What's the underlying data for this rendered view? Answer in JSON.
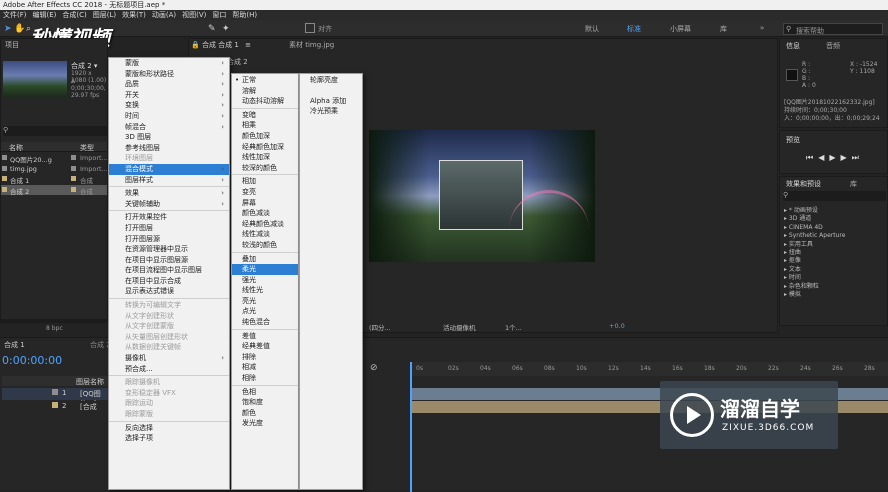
{
  "window": {
    "title": "Adobe After Effects CC 2018 - 无标题项目.aep *"
  },
  "menubar": [
    "文件(F)",
    "编辑(E)",
    "合成(C)",
    "图层(L)",
    "效果(T)",
    "动画(A)",
    "视图(V)",
    "窗口",
    "帮助(H)"
  ],
  "toolbar": {
    "align_label": "对齐",
    "workspaces": [
      "默认",
      "标准",
      "小屏幕",
      "库"
    ],
    "active_workspace": "标准",
    "search_placeholder": "搜索帮助"
  },
  "watermark_top": "秒懂视频",
  "project_panel": {
    "tab": "项目",
    "selected": "合成 2 ▾",
    "info_lines": [
      "1920 x 1080 (1.00)",
      "Δ 0;00;30;00, 29.97 fps"
    ],
    "search_icon": "search-icon",
    "columns": [
      "名称",
      "类型"
    ],
    "items": [
      {
        "name": "QQ图片20...g",
        "type": "Import...",
        "color": "#8f8f8f"
      },
      {
        "name": "timg.jpg",
        "type": "Import...",
        "color": "#8f8f8f"
      },
      {
        "name": "合成 1",
        "type": "合成",
        "color": "#c8b07a"
      },
      {
        "name": "合成 2",
        "type": "合成",
        "color": "#c8b07a"
      }
    ],
    "bpc": "8 bpc"
  },
  "comp_panel": {
    "tabs": [
      "合成 合成 1",
      "素材 timg.jpg"
    ],
    "subtab": "合成 2",
    "zoom": "(四分...",
    "camera": "活动摄像机",
    "views": "1个...",
    "exposure": "+0.0"
  },
  "info_panel": {
    "tabs": [
      "信息",
      "音频"
    ],
    "channels": [
      "R :",
      "G :",
      "B :",
      "A : 0"
    ],
    "coords": [
      "X : -1524",
      "Y : 1108"
    ],
    "file_lines": [
      "[QQ图片20181022162332.jpg]",
      "持续时间：0;00;30;00",
      "入：0;00;00;00，出：0;00;29;24"
    ]
  },
  "preview_panel": {
    "tab": "预览"
  },
  "effects_panel": {
    "tabs": [
      "效果和预设",
      "库"
    ],
    "items": [
      "* 动画预设",
      "3D 通道",
      "CINEMA 4D",
      "Synthetic Aperture",
      "实用工具",
      "扭曲",
      "抠像",
      "文本",
      "时间",
      "杂色和颗粒",
      "模拟"
    ]
  },
  "timeline": {
    "tabs": [
      "合成 1",
      "合成 2"
    ],
    "timecode": "0:00:00:00",
    "col_header": "图层名称",
    "layers": [
      {
        "num": "1",
        "name": "[QQ图片...]"
      },
      {
        "num": "2",
        "name": "[合成"
      }
    ],
    "ruler": [
      "0s",
      "02s",
      "04s",
      "06s",
      "08s",
      "10s",
      "12s",
      "14s",
      "16s",
      "18s",
      "20s",
      "22s",
      "24s",
      "26s",
      "28s"
    ]
  },
  "context_menu": {
    "items": [
      {
        "label": "蒙版",
        "arrow": true
      },
      {
        "label": "蒙版和形状路径",
        "arrow": true
      },
      {
        "label": "品质",
        "arrow": true
      },
      {
        "label": "开关",
        "arrow": true
      },
      {
        "label": "变换",
        "arrow": true
      },
      {
        "label": "时间",
        "arrow": true
      },
      {
        "label": "帧混合",
        "arrow": true
      },
      {
        "label": "3D 图层"
      },
      {
        "label": "参考线图层"
      },
      {
        "label": "环境图层",
        "disabled": true
      },
      {
        "label": "混合模式",
        "arrow": true,
        "selected": true
      },
      {
        "label": "图层样式",
        "arrow": true
      },
      {
        "sep": true
      },
      {
        "label": "效果",
        "arrow": true
      },
      {
        "label": "关键帧辅助",
        "arrow": true
      },
      {
        "sep": true
      },
      {
        "label": "打开效果控件"
      },
      {
        "label": "打开图层"
      },
      {
        "label": "打开图层源"
      },
      {
        "label": "在资源管理器中显示"
      },
      {
        "label": "在项目中显示图层源"
      },
      {
        "label": "在项目流程图中显示图层"
      },
      {
        "label": "在项目中显示合成"
      },
      {
        "label": "显示表达式错误"
      },
      {
        "sep": true
      },
      {
        "label": "转换为可编辑文字",
        "disabled": true
      },
      {
        "label": "从文字创建形状",
        "disabled": true
      },
      {
        "label": "从文字创建蒙版",
        "disabled": true
      },
      {
        "label": "从矢量图层创建形状",
        "disabled": true
      },
      {
        "label": "从数据创建关键帧",
        "disabled": true
      },
      {
        "label": "摄像机",
        "arrow": true
      },
      {
        "label": "预合成..."
      },
      {
        "sep": true
      },
      {
        "label": "跟踪摄像机",
        "disabled": true
      },
      {
        "label": "变形稳定器 VFX",
        "disabled": true
      },
      {
        "label": "跟踪运动",
        "disabled": true
      },
      {
        "label": "跟踪蒙版",
        "disabled": true
      },
      {
        "sep": true
      },
      {
        "label": "反向选择"
      },
      {
        "label": "选择子项"
      }
    ]
  },
  "blend_submenu": {
    "items": [
      {
        "label": "正常",
        "checked": true
      },
      {
        "label": "溶解"
      },
      {
        "label": "动态抖动溶解"
      },
      {
        "sep": true
      },
      {
        "label": "变暗"
      },
      {
        "label": "相乘"
      },
      {
        "label": "颜色加深"
      },
      {
        "label": "经典颜色加深"
      },
      {
        "label": "线性加深"
      },
      {
        "label": "较深的颜色"
      },
      {
        "sep": true
      },
      {
        "label": "相加"
      },
      {
        "label": "变亮"
      },
      {
        "label": "屏幕"
      },
      {
        "label": "颜色减淡"
      },
      {
        "label": "经典颜色减淡"
      },
      {
        "label": "线性减淡"
      },
      {
        "label": "较浅的颜色"
      },
      {
        "sep": true
      },
      {
        "label": "叠加"
      },
      {
        "label": "柔光",
        "selected": true
      },
      {
        "label": "强光"
      },
      {
        "label": "线性光"
      },
      {
        "label": "亮光"
      },
      {
        "label": "点光"
      },
      {
        "label": "纯色混合"
      },
      {
        "sep": true
      },
      {
        "label": "差值"
      },
      {
        "label": "经典差值"
      },
      {
        "label": "排除"
      },
      {
        "label": "相减"
      },
      {
        "label": "相除"
      },
      {
        "sep": true
      },
      {
        "label": "色相"
      },
      {
        "label": "饱和度"
      },
      {
        "label": "颜色"
      },
      {
        "label": "发光度"
      }
    ]
  },
  "blend_submenu2": {
    "items": [
      "轮廓亮度",
      "Alpha 添加",
      "冷光预乘"
    ]
  },
  "watermark_corner": {
    "title": "溜溜自学",
    "url": "ZIXUE.3D66.COM"
  }
}
